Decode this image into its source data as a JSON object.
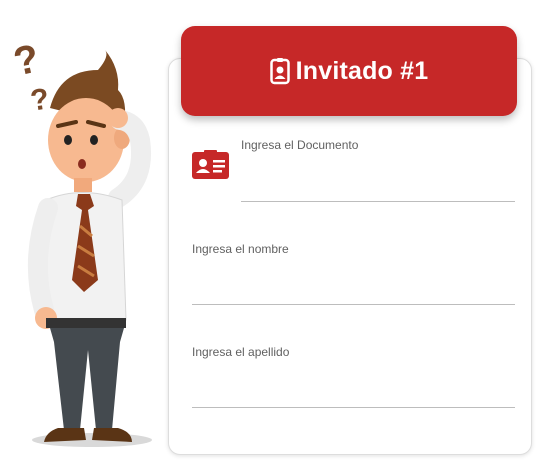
{
  "header": {
    "title": "Invitado #1",
    "icon": "badge-icon",
    "background": "#c62828"
  },
  "form": {
    "documento": {
      "label": "Ingresa el Documento",
      "value": "",
      "icon": "id-card-icon"
    },
    "nombre": {
      "label": "Ingresa el nombre",
      "value": ""
    },
    "apellido": {
      "label": "Ingresa el apellido",
      "value": ""
    }
  },
  "illustration": {
    "description_icon": "confused-man-illustration"
  },
  "colors": {
    "accent": "#c62828",
    "line": "#bdbdbd",
    "label": "#616161"
  }
}
